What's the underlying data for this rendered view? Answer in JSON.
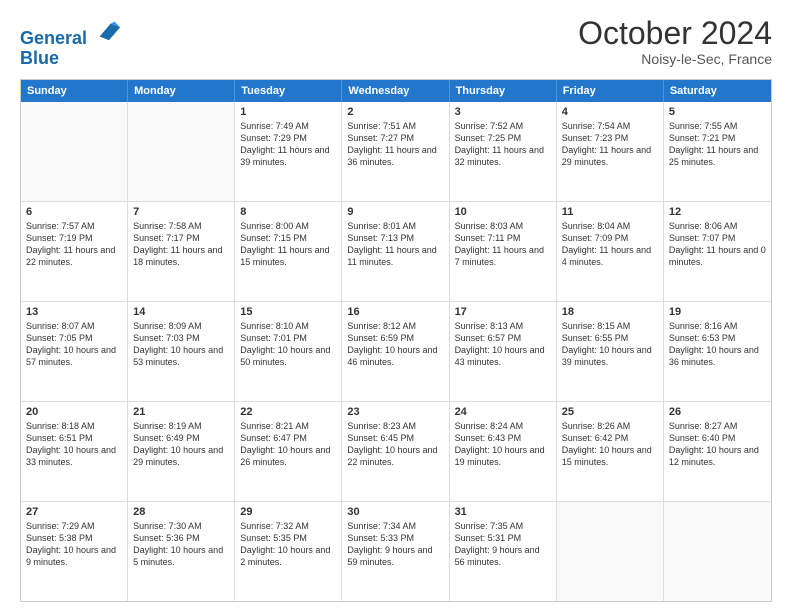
{
  "header": {
    "logo_line1": "General",
    "logo_line2": "Blue",
    "month": "October 2024",
    "location": "Noisy-le-Sec, France"
  },
  "weekdays": [
    "Sunday",
    "Monday",
    "Tuesday",
    "Wednesday",
    "Thursday",
    "Friday",
    "Saturday"
  ],
  "rows": [
    [
      {
        "day": null,
        "empty": true
      },
      {
        "day": null,
        "empty": true
      },
      {
        "day": "1",
        "sunrise": "7:49 AM",
        "sunset": "7:29 PM",
        "daylight": "11 hours and 39 minutes."
      },
      {
        "day": "2",
        "sunrise": "7:51 AM",
        "sunset": "7:27 PM",
        "daylight": "11 hours and 36 minutes."
      },
      {
        "day": "3",
        "sunrise": "7:52 AM",
        "sunset": "7:25 PM",
        "daylight": "11 hours and 32 minutes."
      },
      {
        "day": "4",
        "sunrise": "7:54 AM",
        "sunset": "7:23 PM",
        "daylight": "11 hours and 29 minutes."
      },
      {
        "day": "5",
        "sunrise": "7:55 AM",
        "sunset": "7:21 PM",
        "daylight": "11 hours and 25 minutes."
      }
    ],
    [
      {
        "day": "6",
        "sunrise": "7:57 AM",
        "sunset": "7:19 PM",
        "daylight": "11 hours and 22 minutes."
      },
      {
        "day": "7",
        "sunrise": "7:58 AM",
        "sunset": "7:17 PM",
        "daylight": "11 hours and 18 minutes."
      },
      {
        "day": "8",
        "sunrise": "8:00 AM",
        "sunset": "7:15 PM",
        "daylight": "11 hours and 15 minutes."
      },
      {
        "day": "9",
        "sunrise": "8:01 AM",
        "sunset": "7:13 PM",
        "daylight": "11 hours and 11 minutes."
      },
      {
        "day": "10",
        "sunrise": "8:03 AM",
        "sunset": "7:11 PM",
        "daylight": "11 hours and 7 minutes."
      },
      {
        "day": "11",
        "sunrise": "8:04 AM",
        "sunset": "7:09 PM",
        "daylight": "11 hours and 4 minutes."
      },
      {
        "day": "12",
        "sunrise": "8:06 AM",
        "sunset": "7:07 PM",
        "daylight": "11 hours and 0 minutes."
      }
    ],
    [
      {
        "day": "13",
        "sunrise": "8:07 AM",
        "sunset": "7:05 PM",
        "daylight": "10 hours and 57 minutes."
      },
      {
        "day": "14",
        "sunrise": "8:09 AM",
        "sunset": "7:03 PM",
        "daylight": "10 hours and 53 minutes."
      },
      {
        "day": "15",
        "sunrise": "8:10 AM",
        "sunset": "7:01 PM",
        "daylight": "10 hours and 50 minutes."
      },
      {
        "day": "16",
        "sunrise": "8:12 AM",
        "sunset": "6:59 PM",
        "daylight": "10 hours and 46 minutes."
      },
      {
        "day": "17",
        "sunrise": "8:13 AM",
        "sunset": "6:57 PM",
        "daylight": "10 hours and 43 minutes."
      },
      {
        "day": "18",
        "sunrise": "8:15 AM",
        "sunset": "6:55 PM",
        "daylight": "10 hours and 39 minutes."
      },
      {
        "day": "19",
        "sunrise": "8:16 AM",
        "sunset": "6:53 PM",
        "daylight": "10 hours and 36 minutes."
      }
    ],
    [
      {
        "day": "20",
        "sunrise": "8:18 AM",
        "sunset": "6:51 PM",
        "daylight": "10 hours and 33 minutes."
      },
      {
        "day": "21",
        "sunrise": "8:19 AM",
        "sunset": "6:49 PM",
        "daylight": "10 hours and 29 minutes."
      },
      {
        "day": "22",
        "sunrise": "8:21 AM",
        "sunset": "6:47 PM",
        "daylight": "10 hours and 26 minutes."
      },
      {
        "day": "23",
        "sunrise": "8:23 AM",
        "sunset": "6:45 PM",
        "daylight": "10 hours and 22 minutes."
      },
      {
        "day": "24",
        "sunrise": "8:24 AM",
        "sunset": "6:43 PM",
        "daylight": "10 hours and 19 minutes."
      },
      {
        "day": "25",
        "sunrise": "8:26 AM",
        "sunset": "6:42 PM",
        "daylight": "10 hours and 15 minutes."
      },
      {
        "day": "26",
        "sunrise": "8:27 AM",
        "sunset": "6:40 PM",
        "daylight": "10 hours and 12 minutes."
      }
    ],
    [
      {
        "day": "27",
        "sunrise": "7:29 AM",
        "sunset": "5:38 PM",
        "daylight": "10 hours and 9 minutes."
      },
      {
        "day": "28",
        "sunrise": "7:30 AM",
        "sunset": "5:36 PM",
        "daylight": "10 hours and 5 minutes."
      },
      {
        "day": "29",
        "sunrise": "7:32 AM",
        "sunset": "5:35 PM",
        "daylight": "10 hours and 2 minutes."
      },
      {
        "day": "30",
        "sunrise": "7:34 AM",
        "sunset": "5:33 PM",
        "daylight": "9 hours and 59 minutes."
      },
      {
        "day": "31",
        "sunrise": "7:35 AM",
        "sunset": "5:31 PM",
        "daylight": "9 hours and 56 minutes."
      },
      {
        "day": null,
        "empty": true
      },
      {
        "day": null,
        "empty": true
      }
    ]
  ]
}
